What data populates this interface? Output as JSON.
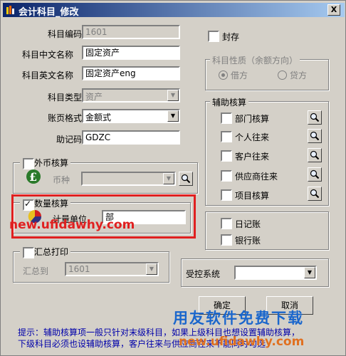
{
  "window": {
    "title": "会计科目_修改",
    "close_label": "X"
  },
  "fields": {
    "code_label": "科目编码",
    "code_value": "1601",
    "cn_name_label": "科目中文名称",
    "cn_name_value": "固定资产",
    "en_name_label": "科目英文名称",
    "en_name_value": "固定资产eng",
    "type_label": "科目类型",
    "type_value": "资产",
    "format_label": "账页格式",
    "format_value": "金额式",
    "mnemonic_label": "助记码",
    "mnemonic_value": "GDZC"
  },
  "seal": {
    "label": "封存",
    "checked": false
  },
  "nature": {
    "title": "科目性质（余额方向）",
    "debit": "借方",
    "credit": "贷方",
    "selected": "debit"
  },
  "aux": {
    "title": "辅助核算",
    "items": [
      {
        "label": "部门核算",
        "checked": false
      },
      {
        "label": "个人往来",
        "checked": false
      },
      {
        "label": "客户往来",
        "checked": false
      },
      {
        "label": "供应商往来",
        "checked": false
      },
      {
        "label": "项目核算",
        "checked": false
      }
    ]
  },
  "journals": {
    "daily": "日记账",
    "bank": "银行账"
  },
  "foreign": {
    "title": "外币核算",
    "currency_label": "币种",
    "currency_value": ""
  },
  "quantity": {
    "title": "数量核算",
    "checked": true,
    "unit_label": "计量单位",
    "unit_value": "部"
  },
  "summary": {
    "title": "汇总打印",
    "to_label": "汇总到",
    "to_value": "1601"
  },
  "controlled": {
    "label": "受控系统",
    "value": ""
  },
  "buttons": {
    "ok": "确定",
    "cancel": "取消"
  },
  "hint": {
    "line1": "提示：辅助核算项一般只针对末级科目，如果上级科目也想设置辅助核算，",
    "line2": "    下级科目必须也设辅助核算，客户往来与供应商往来不能同时勾选"
  },
  "watermarks": {
    "top": "new.ufidawhy.com",
    "brand": "用友软件免费下载",
    "bottom": "new.ufidawhy.com"
  },
  "colors": {
    "title_bar": "#0a246a",
    "highlight": "#e02020",
    "hint_text": "#0000aa"
  }
}
